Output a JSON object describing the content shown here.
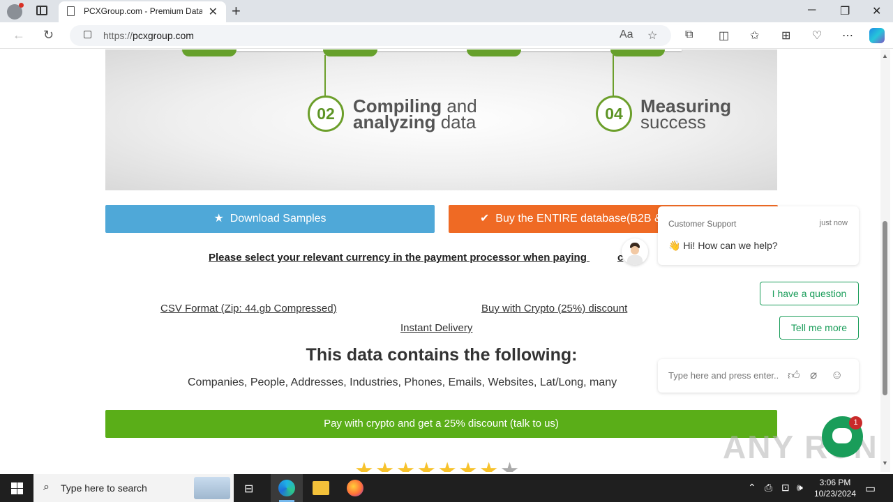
{
  "browser": {
    "tab_title": "PCXGroup.com - Premium Data",
    "url_scheme": "https://",
    "url_host": "pcxgroup.com"
  },
  "hero": {
    "step2_num": "02",
    "step2_bold1": "Compiling",
    "step2_rest1": " and",
    "step2_bold2": "analyzing",
    "step2_rest2": " data",
    "step4_num": "04",
    "step4_bold": "Measuring",
    "step4_rest": "success"
  },
  "buttons": {
    "download_samples": "Download Samples",
    "buy_entire": "Buy the ENTIRE database(B2B & B"
  },
  "notice": "Please select your relevant currency in the payment processor when paying",
  "notice_tail": "c",
  "links": {
    "csv_format": "CSV Format (Zip: 44.gb Compressed)",
    "buy_crypto": "Buy with Crypto (25%) discount",
    "instant_delivery": "Instant Delivery"
  },
  "section_heading": "This data contains the following:",
  "contains_list": "Companies, People, Addresses, Industries, Phones, Emails, Websites, Lat/Long, many",
  "pay_crypto_button": "Pay with crypto and get a 25% discount (talk to us)",
  "rating": {
    "stars_filled": 7,
    "stars_total": 8
  },
  "chat": {
    "agent_name": "Customer Support",
    "time": "just now",
    "message": "👋 Hi! How can we help?",
    "option1": "I have a question",
    "option2": "Tell me more",
    "input_placeholder": "Type here and press enter..",
    "unread_count": "1"
  },
  "taskbar": {
    "search_placeholder": "Type here to search",
    "time": "3:06 PM",
    "date": "10/23/2024"
  },
  "watermark": "ANY RUN",
  "colors": {
    "download_blue": "#4fa8d8",
    "buy_orange": "#ef6a24",
    "pay_green": "#5aae18",
    "step_green": "#6c9f2b",
    "chat_green": "#1a9d5a"
  }
}
